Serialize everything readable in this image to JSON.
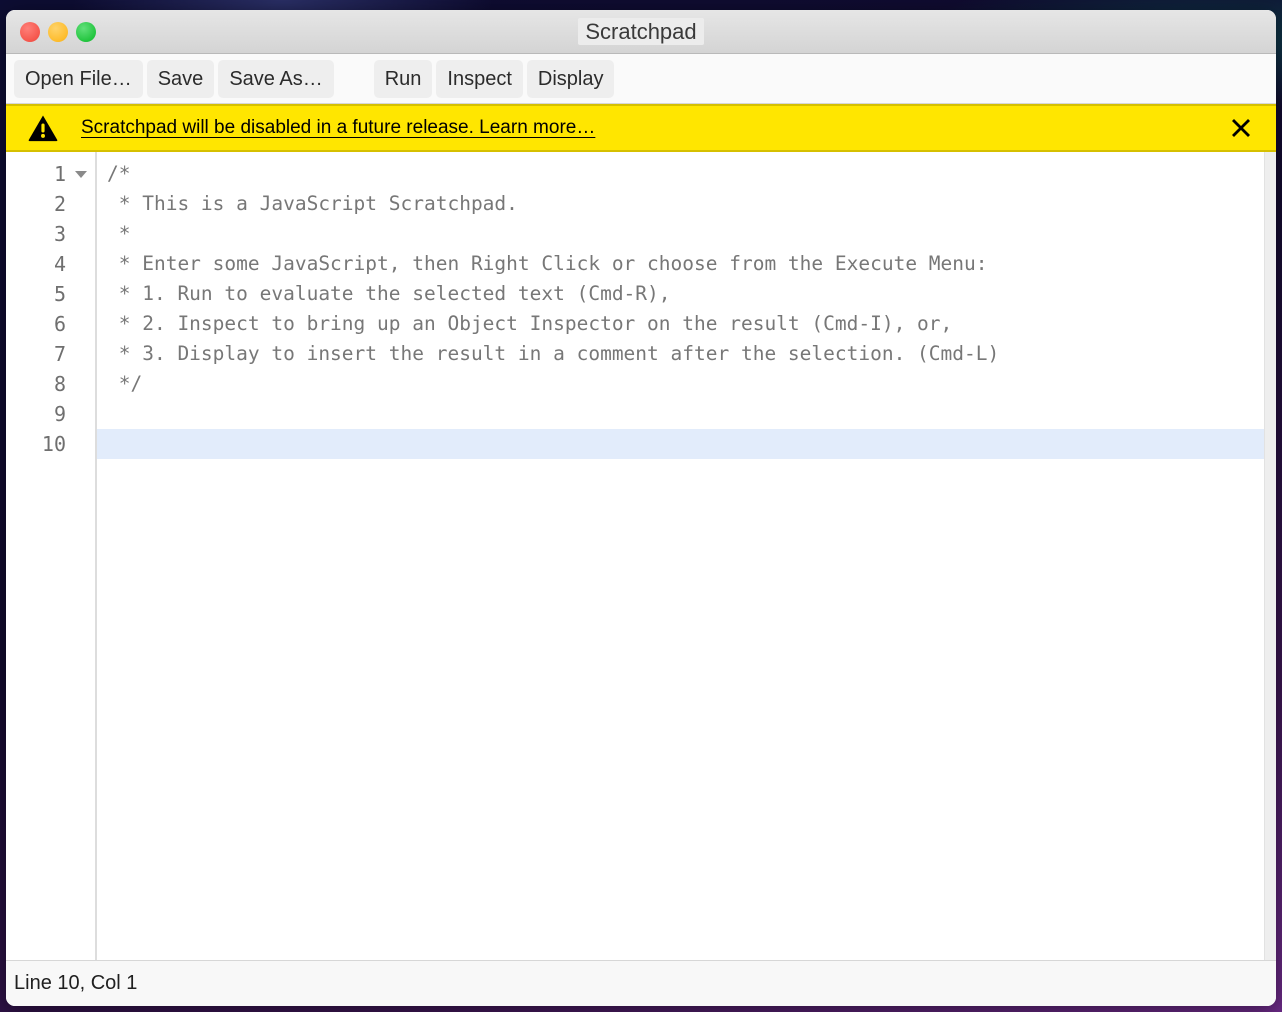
{
  "window": {
    "title": "Scratchpad",
    "traffic_lights": [
      {
        "name": "close-button",
        "color": "#f5564c"
      },
      {
        "name": "minimize-button",
        "color": "#fdbc2c"
      },
      {
        "name": "maximize-button",
        "color": "#23c53f"
      }
    ]
  },
  "toolbar": {
    "buttons_left": [
      {
        "label": "Open File…"
      },
      {
        "label": "Save"
      },
      {
        "label": "Save As…"
      }
    ],
    "buttons_right": [
      {
        "label": "Run"
      },
      {
        "label": "Inspect"
      },
      {
        "label": "Display"
      }
    ]
  },
  "notification": {
    "icon": "warning-triangle-icon",
    "message": "Scratchpad will be disabled in a future release. Learn more…",
    "close_icon": "close-icon",
    "background": "#ffe600",
    "text_color": "#000000"
  },
  "editor": {
    "gutter": {
      "line_numbers": [
        "1",
        "2",
        "3",
        "4",
        "5",
        "6",
        "7",
        "8",
        "9",
        "10"
      ],
      "fold_marker_line": "1"
    },
    "active_line": 10,
    "active_line_color": "#e2ecfb",
    "code_color": "#777777",
    "lines": [
      "/*",
      " * This is a JavaScript Scratchpad.",
      " *",
      " * Enter some JavaScript, then Right Click or choose from the Execute Menu:",
      " * 1. Run to evaluate the selected text (Cmd-R),",
      " * 2. Inspect to bring up an Object Inspector on the result (Cmd-I), or,",
      " * 3. Display to insert the result in a comment after the selection. (Cmd-L)",
      " */",
      "",
      ""
    ]
  },
  "statusbar": {
    "position": "Line 10, Col 1"
  }
}
